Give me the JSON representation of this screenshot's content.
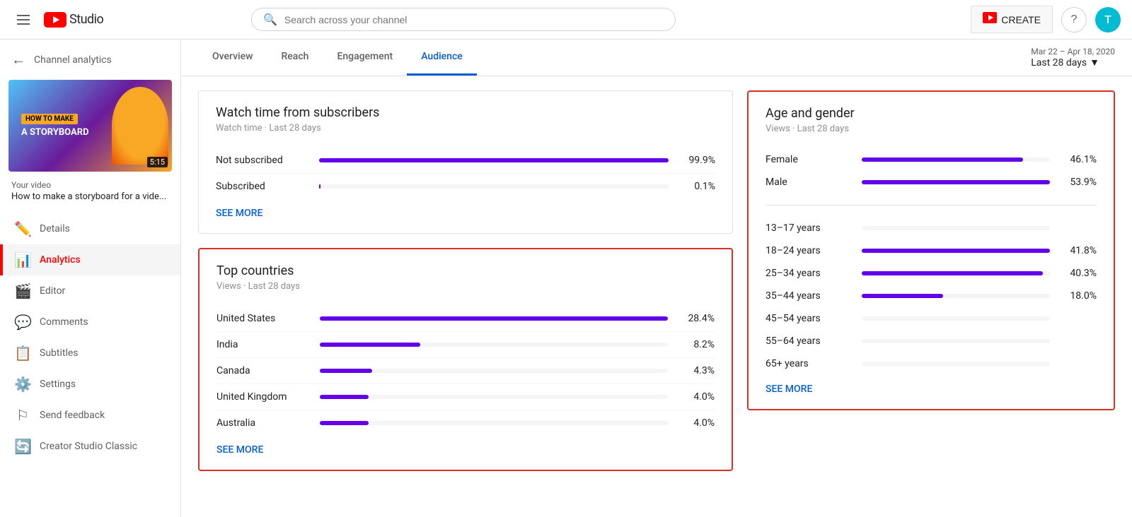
{
  "header": {
    "menu_label": "Menu",
    "logo_text": "Studio",
    "search_placeholder": "Search across your channel",
    "create_label": "CREATE",
    "help_label": "?",
    "avatar_letter": "T"
  },
  "sidebar": {
    "back_label": "Channel analytics",
    "thumb": {
      "badge": "HOW TO MAKE",
      "title": "A STORYBOARD",
      "duration": "5:15"
    },
    "your_video_label": "Your video",
    "video_title": "How to make a storyboard for a vide...",
    "nav_items": [
      {
        "id": "details",
        "label": "Details",
        "icon": "✏️"
      },
      {
        "id": "analytics",
        "label": "Analytics",
        "icon": "📊",
        "active": true
      },
      {
        "id": "editor",
        "label": "Editor",
        "icon": "🎬"
      },
      {
        "id": "comments",
        "label": "Comments",
        "icon": "💬"
      },
      {
        "id": "subtitles",
        "label": "Subtitles",
        "icon": "📋"
      },
      {
        "id": "settings",
        "label": "Settings",
        "icon": "⚙️"
      },
      {
        "id": "feedback",
        "label": "Send feedback",
        "icon": "⚑"
      },
      {
        "id": "classic",
        "label": "Creator Studio Classic",
        "icon": "🔄"
      }
    ]
  },
  "tabs": {
    "items": [
      {
        "id": "overview",
        "label": "Overview",
        "active": false
      },
      {
        "id": "reach",
        "label": "Reach",
        "active": false
      },
      {
        "id": "engagement",
        "label": "Engagement",
        "active": false
      },
      {
        "id": "audience",
        "label": "Audience",
        "active": true
      }
    ]
  },
  "date_range": {
    "range_text": "Mar 22 – Apr 18, 2020",
    "period_label": "Last 28 days"
  },
  "watch_time_card": {
    "title": "Watch time from subscribers",
    "subtitle": "Watch time · Last 28 days",
    "rows": [
      {
        "label": "Not subscribed",
        "bar_pct": 99.9,
        "value": "99.9%",
        "tiny": false
      },
      {
        "label": "Subscribed",
        "bar_pct": 0.1,
        "value": "0.1%",
        "tiny": true
      }
    ],
    "see_more": "SEE MORE"
  },
  "top_countries_card": {
    "title": "Top countries",
    "subtitle": "Views · Last 28 days",
    "highlighted": true,
    "rows": [
      {
        "label": "United States",
        "bar_pct": 28.4,
        "value": "28.4%"
      },
      {
        "label": "India",
        "bar_pct": 8.2,
        "value": "8.2%"
      },
      {
        "label": "Canada",
        "bar_pct": 4.3,
        "value": "4.3%"
      },
      {
        "label": "United Kingdom",
        "bar_pct": 4.0,
        "value": "4.0%"
      },
      {
        "label": "Australia",
        "bar_pct": 4.0,
        "value": "4.0%"
      }
    ],
    "see_more": "SEE MORE"
  },
  "age_gender_card": {
    "title": "Age and gender",
    "subtitle": "Views · Last 28 days",
    "highlighted": true,
    "gender_rows": [
      {
        "label": "Female",
        "bar_pct": 46.1,
        "value": "46.1%"
      },
      {
        "label": "Male",
        "bar_pct": 53.9,
        "value": "53.9%"
      }
    ],
    "age_rows": [
      {
        "label": "13–17 years",
        "bar_pct": 0,
        "value": ""
      },
      {
        "label": "18–24 years",
        "bar_pct": 41.8,
        "value": "41.8%"
      },
      {
        "label": "25–34 years",
        "bar_pct": 40.3,
        "value": "40.3%"
      },
      {
        "label": "35–44 years",
        "bar_pct": 18.0,
        "value": "18.0%"
      },
      {
        "label": "45–54 years",
        "bar_pct": 0,
        "value": ""
      },
      {
        "label": "55–64 years",
        "bar_pct": 0,
        "value": ""
      },
      {
        "label": "65+ years",
        "bar_pct": 0,
        "value": ""
      }
    ],
    "see_more": "SEE MORE"
  }
}
